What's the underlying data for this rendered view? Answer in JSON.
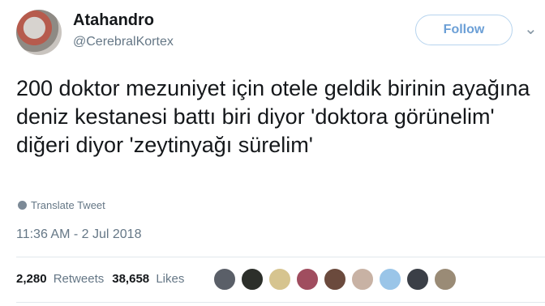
{
  "header": {
    "display_name": "Atahandro",
    "handle": "@CerebralKortex",
    "follow_label": "Follow",
    "chevron_icon": "chevron-down-icon"
  },
  "tweet": {
    "text": "200 doktor mezuniyet için otele geldik birinin ayağına deniz kestanesi battı biri diyor 'doktora görünelim' diğeri diyor 'zeytinyağı sürelim'",
    "translate_label": "Translate Tweet",
    "timestamp": "11:36 AM - 2 Jul 2018"
  },
  "stats": {
    "retweets_count": "2,280",
    "retweets_label": "Retweets",
    "likes_count": "38,658",
    "likes_label": "Likes"
  },
  "likers": [
    {
      "color": "#5a5f68"
    },
    {
      "color": "#2c2f2a"
    },
    {
      "color": "#d6c48f"
    },
    {
      "color": "#a04d5f"
    },
    {
      "color": "#6b4a3d"
    },
    {
      "color": "#c8b2a4"
    },
    {
      "color": "#9ac5e8"
    },
    {
      "color": "#3b3f47"
    },
    {
      "color": "#9a8b76"
    }
  ]
}
